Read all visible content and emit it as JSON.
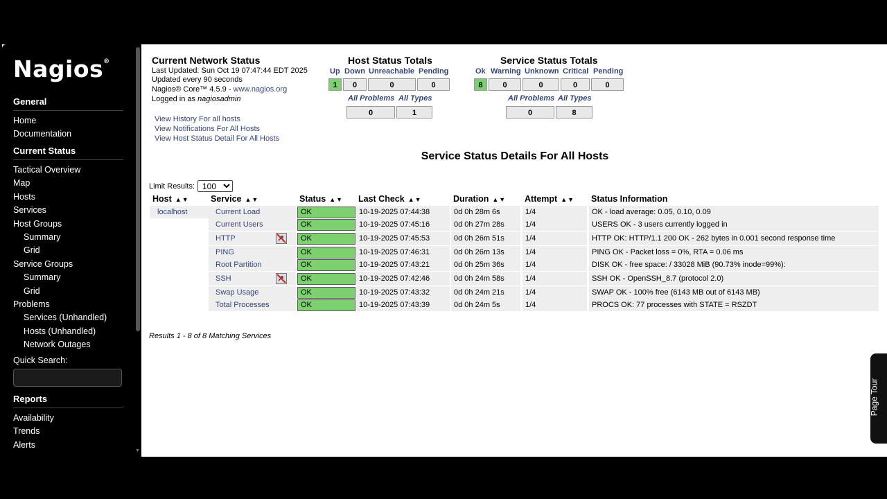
{
  "logo": "Nagios",
  "sidebar": {
    "general_head": "General",
    "general_items": [
      "Home",
      "Documentation"
    ],
    "current_status_head": "Current Status",
    "status_items": [
      {
        "label": "Tactical Overview",
        "sub": false
      },
      {
        "label": "Map",
        "sub": false
      },
      {
        "label": "Hosts",
        "sub": false
      },
      {
        "label": "Services",
        "sub": false
      },
      {
        "label": "Host Groups",
        "sub": false
      },
      {
        "label": "Summary",
        "sub": true
      },
      {
        "label": "Grid",
        "sub": true
      },
      {
        "label": "Service Groups",
        "sub": false
      },
      {
        "label": "Summary",
        "sub": true
      },
      {
        "label": "Grid",
        "sub": true
      },
      {
        "label": "Problems",
        "sub": false
      },
      {
        "label": "Services (Unhandled)",
        "sub": true
      },
      {
        "label": "Hosts (Unhandled)",
        "sub": true
      },
      {
        "label": "Network Outages",
        "sub": true
      }
    ],
    "quick_search_label": "Quick Search:",
    "quick_search_value": "",
    "reports_head": "Reports",
    "report_items": [
      "Availability",
      "Trends",
      "Alerts"
    ]
  },
  "network_status": {
    "title": "Current Network Status",
    "last_updated": "Last Updated: Sun Oct 19 07:47:44 EDT 2025",
    "update_interval": "Updated every 90 seconds",
    "core_prefix": "Nagios® Core™ 4.5.9 - ",
    "core_link": "www.nagios.org",
    "logged_in_prefix": "Logged in as ",
    "logged_in_user": "nagiosadmin",
    "links": [
      "View History For all hosts",
      "View Notifications For All Hosts",
      "View Host Status Detail For All Hosts"
    ]
  },
  "host_totals": {
    "title": "Host Status Totals",
    "heads": [
      "Up",
      "Down",
      "Unreachable",
      "Pending"
    ],
    "values": [
      "1",
      "0",
      "0",
      "0"
    ],
    "sub_heads": [
      "All Problems",
      "All Types"
    ],
    "sub_values": [
      "0",
      "1"
    ]
  },
  "service_totals": {
    "title": "Service Status Totals",
    "heads": [
      "Ok",
      "Warning",
      "Unknown",
      "Critical",
      "Pending"
    ],
    "values": [
      "8",
      "0",
      "0",
      "0",
      "0"
    ],
    "sub_heads": [
      "All Problems",
      "All Types"
    ],
    "sub_values": [
      "0",
      "8"
    ]
  },
  "details": {
    "title": "Service Status Details For All Hosts",
    "limit_label": "Limit Results:",
    "limit_value": "100",
    "columns": [
      "Host",
      "Service",
      "Status",
      "Last Check",
      "Duration",
      "Attempt",
      "Status Information"
    ],
    "host": "localhost",
    "rows": [
      {
        "service": "Current Load",
        "status": "OK",
        "last_check": "10-19-2025 07:44:38",
        "duration": "0d 0h 28m 6s",
        "attempt": "1/4",
        "info": "OK - load average: 0.05, 0.10, 0.09",
        "icon": false
      },
      {
        "service": "Current Users",
        "status": "OK",
        "last_check": "10-19-2025 07:45:16",
        "duration": "0d 0h 27m 28s",
        "attempt": "1/4",
        "info": "USERS OK - 3 users currently logged in",
        "icon": false
      },
      {
        "service": "HTTP",
        "status": "OK",
        "last_check": "10-19-2025 07:45:53",
        "duration": "0d 0h 26m 51s",
        "attempt": "1/4",
        "info": "HTTP OK: HTTP/1.1 200 OK - 262 bytes in 0.001 second response time",
        "icon": true
      },
      {
        "service": "PING",
        "status": "OK",
        "last_check": "10-19-2025 07:46:31",
        "duration": "0d 0h 26m 13s",
        "attempt": "1/4",
        "info": "PING OK - Packet loss = 0%, RTA = 0.06 ms",
        "icon": false
      },
      {
        "service": "Root Partition",
        "status": "OK",
        "last_check": "10-19-2025 07:43:21",
        "duration": "0d 0h 25m 36s",
        "attempt": "1/4",
        "info": "DISK OK - free space: / 33028 MiB (90.73% inode=99%):",
        "icon": false
      },
      {
        "service": "SSH",
        "status": "OK",
        "last_check": "10-19-2025 07:42:46",
        "duration": "0d 0h 24m 58s",
        "attempt": "1/4",
        "info": "SSH OK - OpenSSH_8.7 (protocol 2.0)",
        "icon": true
      },
      {
        "service": "Swap Usage",
        "status": "OK",
        "last_check": "10-19-2025 07:43:32",
        "duration": "0d 0h 24m 21s",
        "attempt": "1/4",
        "info": "SWAP OK - 100% free (6143 MB out of 6143 MB)",
        "icon": false
      },
      {
        "service": "Total Processes",
        "status": "OK",
        "last_check": "10-19-2025 07:43:39",
        "duration": "0d 0h 24m 5s",
        "attempt": "1/4",
        "info": "PROCS OK: 77 processes with STATE = RSZDT",
        "icon": false
      }
    ],
    "results": "Results 1 - 8 of 8 Matching Services"
  },
  "page_tour": "Page Tour"
}
